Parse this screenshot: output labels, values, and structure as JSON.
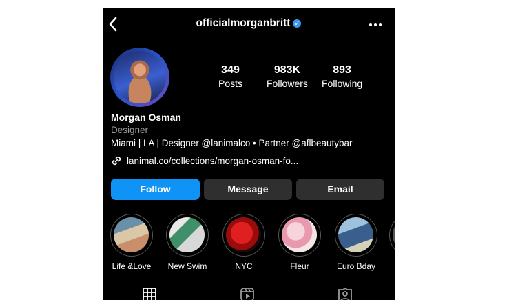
{
  "header": {
    "username": "officialmorganbritt",
    "back_icon": "chevron-left-icon",
    "verified_icon": "verified-badge-icon",
    "more_icon": "more-horizontal-icon"
  },
  "profile": {
    "avatar_icon": "profile-photo",
    "stats": [
      {
        "value": "349",
        "label": "Posts"
      },
      {
        "value": "983K",
        "label": "Followers"
      },
      {
        "value": "893",
        "label": "Following"
      }
    ],
    "name": "Morgan Osman",
    "category": "Designer",
    "bio": "Miami | LA | Designer @lanimalco • Partner @aflbeautybar",
    "link": "lanimal.co/collections/morgan-osman-fo...",
    "link_icon": "link-icon"
  },
  "actions": {
    "follow": "Follow",
    "message": "Message",
    "email": "Email"
  },
  "highlights": [
    {
      "label": "Life &Love"
    },
    {
      "label": "New Swim"
    },
    {
      "label": "NYC"
    },
    {
      "label": "Fleur"
    },
    {
      "label": "Euro Bday"
    }
  ],
  "tabs": [
    "grid-icon",
    "reels-icon",
    "tagged-icon"
  ],
  "colors": {
    "background": "#000000",
    "accent": "#0f94f5",
    "secondary_button": "#2f2f2f",
    "muted_text": "#9a9a9a",
    "verified": "#3897f0"
  }
}
